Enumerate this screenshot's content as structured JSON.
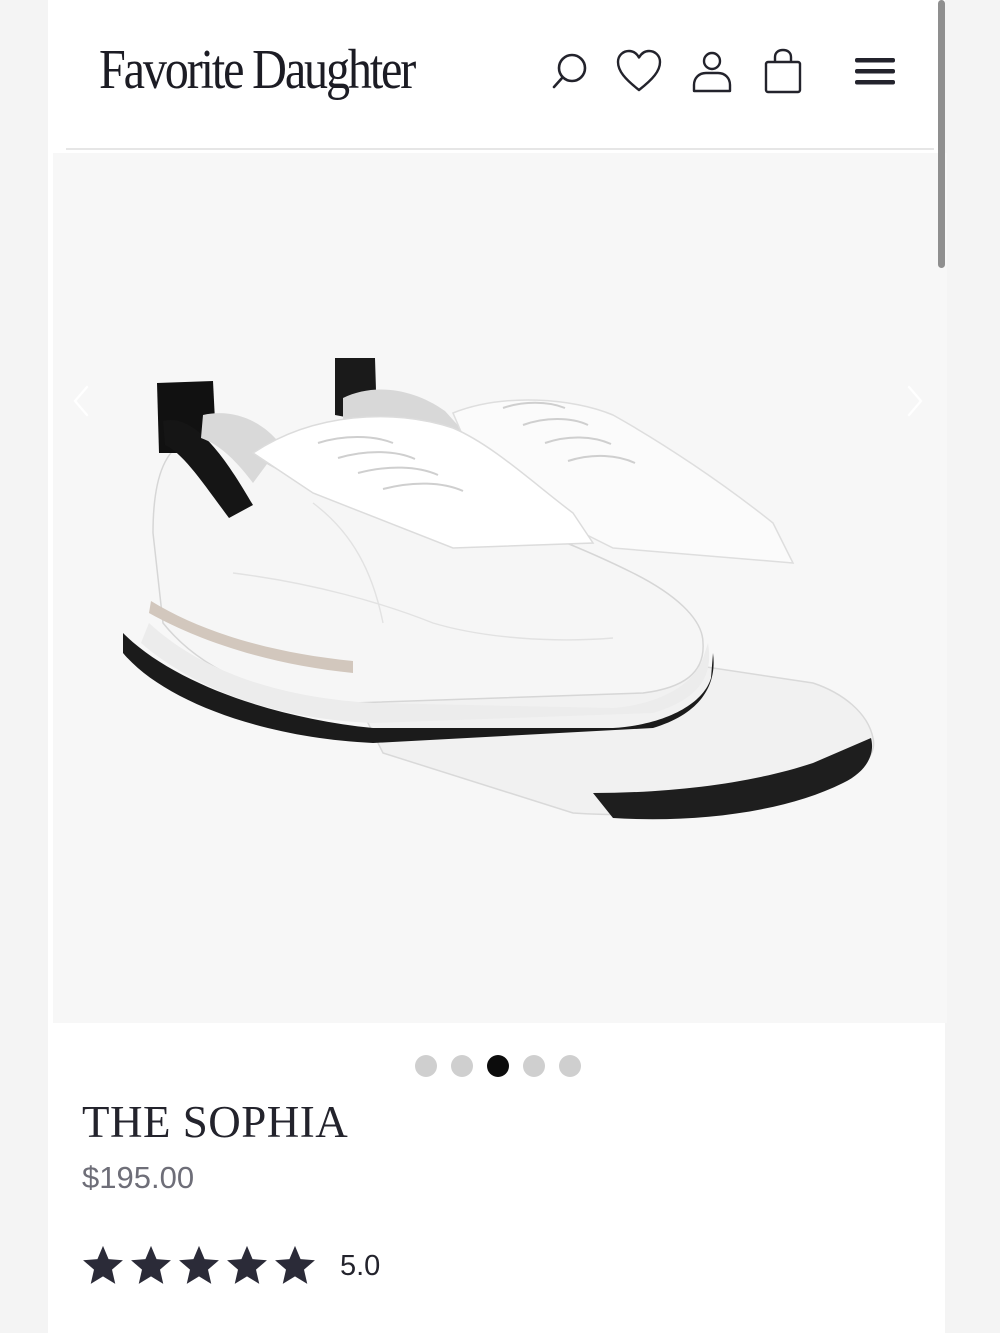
{
  "header": {
    "brand": "Favorite Daughter",
    "icons": [
      "search-icon",
      "heart-icon",
      "account-icon",
      "bag-icon",
      "menu-icon"
    ]
  },
  "carousel": {
    "total_images": 5,
    "active_index": 2,
    "image_subject": "white leather sneakers with black heel tab and black sole"
  },
  "product": {
    "title": "THE SOPHIA",
    "price": "$195.00",
    "rating_value": "5.0",
    "stars_filled": 5
  },
  "colors": {
    "text_dark": "#23232c",
    "price_gray": "#6e6e78",
    "dot_inactive": "#cfcfcf",
    "dot_active": "#0c0c0c",
    "image_bg": "#f7f7f7"
  }
}
